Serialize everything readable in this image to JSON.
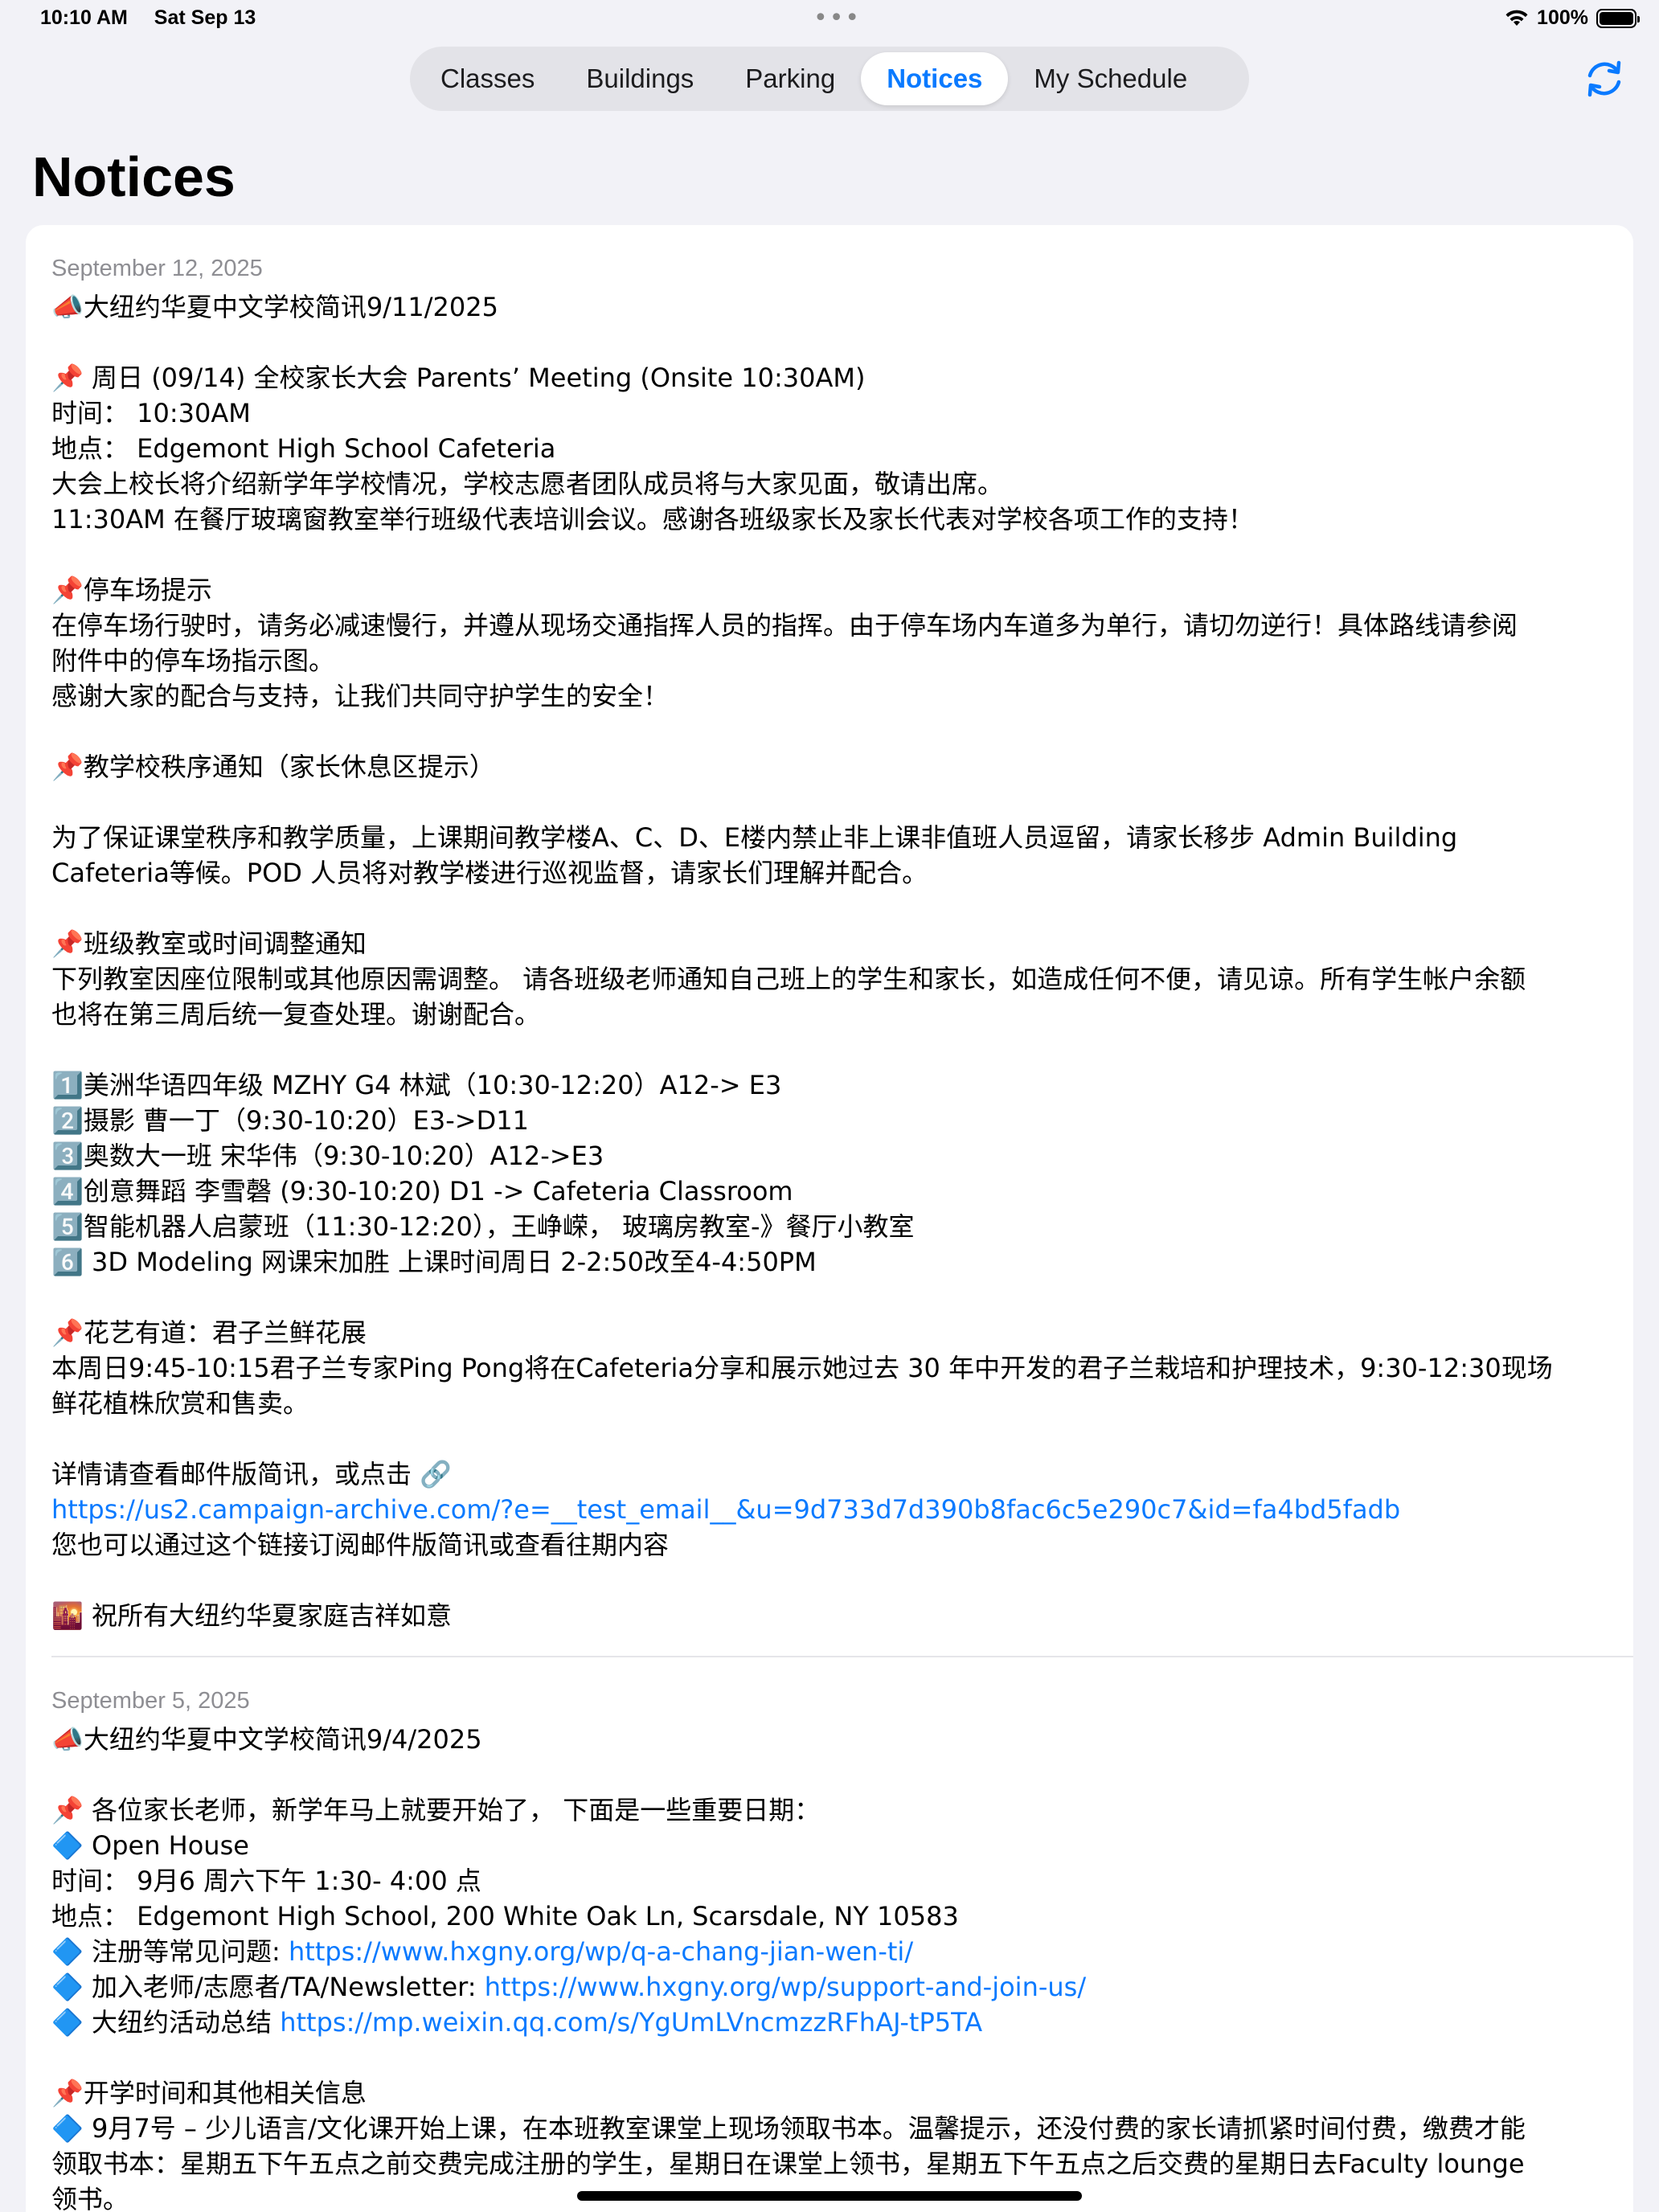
{
  "status_bar": {
    "time": "10:10 AM",
    "date": "Sat Sep 13",
    "dots": "•••",
    "battery_text": "100%"
  },
  "tabs": [
    {
      "label": "Classes",
      "active": false
    },
    {
      "label": "Buildings",
      "active": false
    },
    {
      "label": "Parking",
      "active": false
    },
    {
      "label": "Notices",
      "active": true
    },
    {
      "label": "My Schedule",
      "active": false
    }
  ],
  "page_title": "Notices",
  "accent_color": "#0a7aff",
  "notices": [
    {
      "date": "September 12, 2025",
      "lines": [
        {
          "text": "📣大纽约华夏中文学校简讯9/11/2025"
        },
        {
          "text": ""
        },
        {
          "text": "📌 周日 (09/14) 全校家长大会 Parents’ Meeting (Onsite 10:30AM)"
        },
        {
          "text": "时间： 10:30AM"
        },
        {
          "text": "地点： Edgemont High School Cafeteria"
        },
        {
          "text": "大会上校长将介绍新学年学校情况，学校志愿者团队成员将与大家见面，敬请出席。"
        },
        {
          "text": "11:30AM 在餐厅玻璃窗教室举行班级代表培训会议。感谢各班级家长及家长代表对学校各项工作的支持！"
        },
        {
          "text": ""
        },
        {
          "text": "📌停车场提示"
        },
        {
          "text": "在停车场行驶时，请务必减速慢行，并遵从现场交通指挥人员的指挥。由于停车场内车道多为单行，请切勿逆行！具体路线请参阅"
        },
        {
          "text": "附件中的停车场指示图。"
        },
        {
          "text": "感谢大家的配合与支持，让我们共同守护学生的安全！"
        },
        {
          "text": ""
        },
        {
          "text": "📌教学校秩序通知（家长休息区提示）"
        },
        {
          "text": ""
        },
        {
          "text": "为了保证课堂秩序和教学质量，上课期间教学楼A、C、D、E楼内禁止非上课非值班人员逗留，请家长移步 Admin Building"
        },
        {
          "text": "Cafeteria等候。POD 人员将对教学楼进行巡视监督，请家长们理解并配合。"
        },
        {
          "text": ""
        },
        {
          "text": "📌班级教室或时间调整通知"
        },
        {
          "text": "下列教室因座位限制或其他原因需调整。 请各班级老师通知自己班上的学生和家长，如造成任何不便，请见谅。所有学生帐户余额"
        },
        {
          "text": "也将在第三周后统一复查处理。谢谢配合。"
        },
        {
          "text": ""
        },
        {
          "text": "1️⃣美洲华语四年级 MZHY G4 林斌（10:30-12:20）A12-> E3"
        },
        {
          "text": "2️⃣摄影 曹一丁（9:30-10:20）E3->D11"
        },
        {
          "text": "3️⃣奥数大一班 宋华伟（9:30-10:20）A12->E3"
        },
        {
          "text": "4️⃣创意舞蹈 李雪磬 (9:30-10:20) D1 -> Cafeteria Classroom"
        },
        {
          "text": "5️⃣智能机器人启蒙班（11:30-12:20），王峥嵘，  玻璃房教室-》餐厅小教室"
        },
        {
          "text": "6️⃣ 3D Modeling 网课宋加胜 上课时间周日 2-2:50改至4-4:50PM"
        },
        {
          "text": ""
        },
        {
          "text": "📌花艺有道：君子兰鲜花展"
        },
        {
          "text": "本周日9:45-10:15君子兰专家Ping Pong将在Cafeteria分享和展示她过去 30 年中开发的君子兰栽培和护理技术，9:30-12:30现场"
        },
        {
          "text": "鲜花植株欣赏和售卖。"
        },
        {
          "text": ""
        },
        {
          "text": "详情请查看邮件版简讯，或点击 🔗"
        },
        {
          "text": "https://us2.campaign-archive.com/?e=__test_email__&u=9d733d7d390b8fac6c5e290c7&id=fa4bd5fadb",
          "link": true
        },
        {
          "text": "您也可以通过这个链接订阅邮件版简讯或查看往期内容"
        },
        {
          "text": ""
        },
        {
          "text": "🌇 祝所有大纽约华夏家庭吉祥如意"
        }
      ]
    },
    {
      "date": "September 5, 2025",
      "lines": [
        {
          "text": "📣大纽约华夏中文学校简讯9/4/2025"
        },
        {
          "text": ""
        },
        {
          "text": "📌 各位家长老师，新学年马上就要开始了， 下面是一些重要日期："
        },
        {
          "text": "🔷 Open House"
        },
        {
          "text": "时间： 9月6 周六下午 1:30- 4:00 点"
        },
        {
          "text": "地点： Edgemont High School, 200 White Oak Ln, Scarsdale, NY 10583"
        },
        {
          "text": "🔷 注册等常见问题: ",
          "link_text": "https://www.hxgny.org/wp/q-a-chang-jian-wen-ti/"
        },
        {
          "text": "🔷 加入老师/志愿者/TA/Newsletter: ",
          "link_text": "https://www.hxgny.org/wp/support-and-join-us/"
        },
        {
          "text": "🔷 大纽约活动总结 ",
          "link_text": "https://mp.weixin.qq.com/s/YgUmLVncmzzRFhAJ-tP5TA"
        },
        {
          "text": ""
        },
        {
          "text": "📌开学时间和其他相关信息"
        },
        {
          "text": "🔷 9月7号 – 少儿语言/文化课开始上课，在本班教室课堂上现场领取书本。温馨提示，还没付费的家长请抓紧时间付费，缴费才能"
        },
        {
          "text": "领取书本：星期五下午五点之前交费完成注册的学生，星期日在课堂上领书，星期五下午五点之后交费的星期日去Faculty lounge"
        },
        {
          "text": "领书。"
        }
      ]
    }
  ]
}
